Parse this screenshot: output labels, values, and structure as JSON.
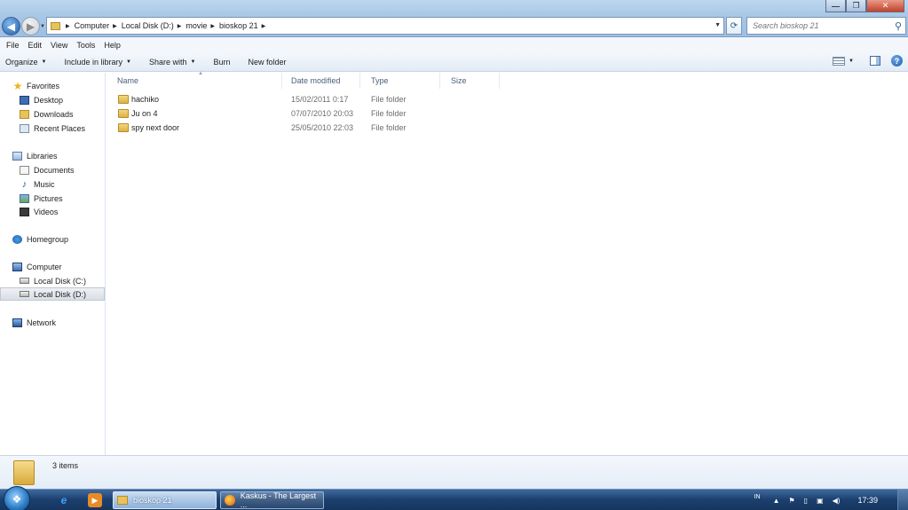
{
  "window": {
    "minimize_label": "—",
    "maximize_label": "❐",
    "close_label": "✕"
  },
  "address": {
    "segments": [
      "Computer",
      "Local Disk (D:)",
      "movie",
      "bioskop 21"
    ]
  },
  "search": {
    "placeholder": "Search bioskop 21"
  },
  "menu": [
    "File",
    "Edit",
    "View",
    "Tools",
    "Help"
  ],
  "toolbar": {
    "organize": "Organize",
    "include_in_library": "Include in library",
    "share_with": "Share with",
    "burn": "Burn",
    "new_folder": "New folder"
  },
  "nav": {
    "favorites": "Favorites",
    "desktop": "Desktop",
    "downloads": "Downloads",
    "recent_places": "Recent Places",
    "libraries": "Libraries",
    "documents": "Documents",
    "music": "Music",
    "pictures": "Pictures",
    "videos": "Videos",
    "homegroup": "Homegroup",
    "computer": "Computer",
    "local_disk_c": "Local Disk (C:)",
    "local_disk_d": "Local Disk (D:)",
    "network": "Network"
  },
  "columns": {
    "name": "Name",
    "date_modified": "Date modified",
    "type": "Type",
    "size": "Size"
  },
  "files": [
    {
      "name": "hachiko",
      "date": "15/02/2011 0:17",
      "type": "File folder"
    },
    {
      "name": "Ju on 4",
      "date": "07/07/2010 20:03",
      "type": "File folder"
    },
    {
      "name": "spy next door",
      "date": "25/05/2010 22:03",
      "type": "File folder"
    }
  ],
  "details": {
    "count": "3 items"
  },
  "taskbar": {
    "explorer_label": "bioskop 21",
    "firefox_label": "Kaskus - The Largest ...",
    "language": "IN",
    "clock": "17:39"
  }
}
